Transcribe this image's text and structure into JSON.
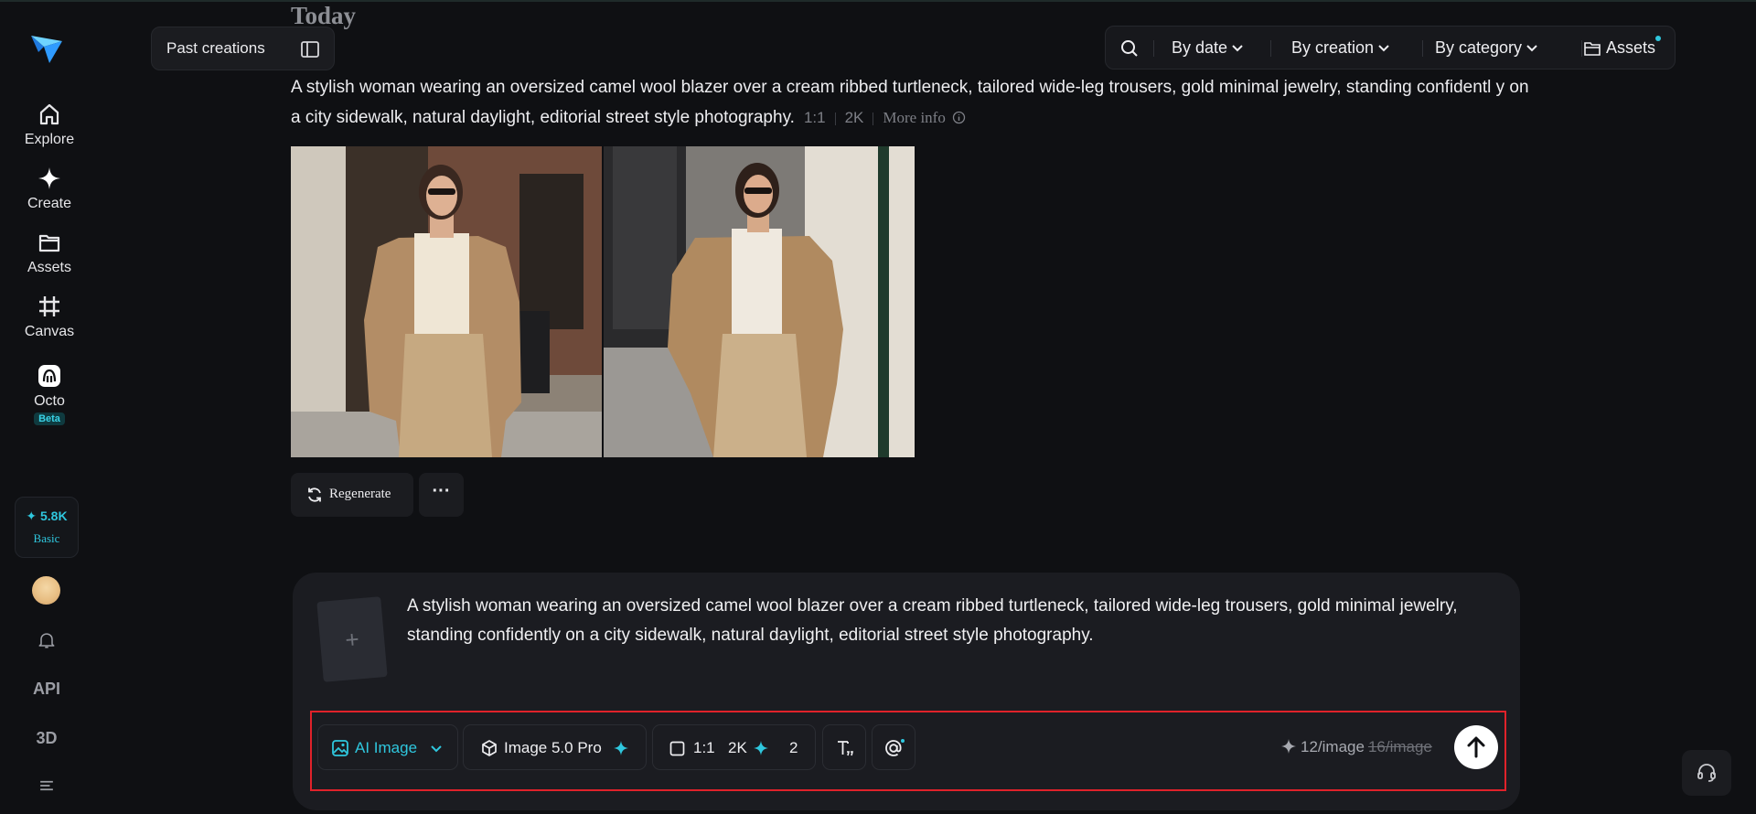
{
  "sidebar": {
    "nav": [
      {
        "label": "Explore",
        "icon": "home-icon"
      },
      {
        "label": "Create",
        "icon": "sparkle-icon"
      },
      {
        "label": "Assets",
        "icon": "folder-icon"
      },
      {
        "label": "Canvas",
        "icon": "frame-icon"
      },
      {
        "label": "Octo",
        "icon": "octo-icon",
        "badge": "Beta"
      }
    ],
    "credits": {
      "amount": "✦ 5.8K",
      "plan": "Basic"
    },
    "api_label": "API",
    "three_d_label": "3D"
  },
  "header": {
    "past_creations": "Past creations",
    "section_title": "Today",
    "filters": {
      "by_date": "By date",
      "by_creation": "By creation",
      "by_category": "By category",
      "assets": "Assets"
    }
  },
  "result": {
    "prompt": "A stylish woman wearing an oversized camel wool blazer over a cream ribbed turtleneck, tailored wide-leg trousers, gold minimal jewelry, standing confidentl y on a city sidewalk, natural daylight, editorial street style photography.",
    "ratio": "1:1",
    "resolution": "2K",
    "more_info": "More info",
    "regenerate": "Regenerate",
    "more": "···"
  },
  "composer": {
    "text": "A stylish woman wearing an oversized camel wool blazer over a cream ribbed turtleneck, tailored wide-leg trousers, gold minimal jewelry, standing confidently on a city sidewalk, natural daylight, editorial street style photography.",
    "upload_glyph": "+",
    "mode": "AI Image",
    "model": "Image 5.0 Pro",
    "ratio": "1:1",
    "resolution": "2K",
    "count": "2",
    "cost": "12/image",
    "old_cost": "16/image"
  },
  "colors": {
    "accent": "#2fc7de",
    "highlight_outline": "#e0222a",
    "background": "#0f1013"
  }
}
